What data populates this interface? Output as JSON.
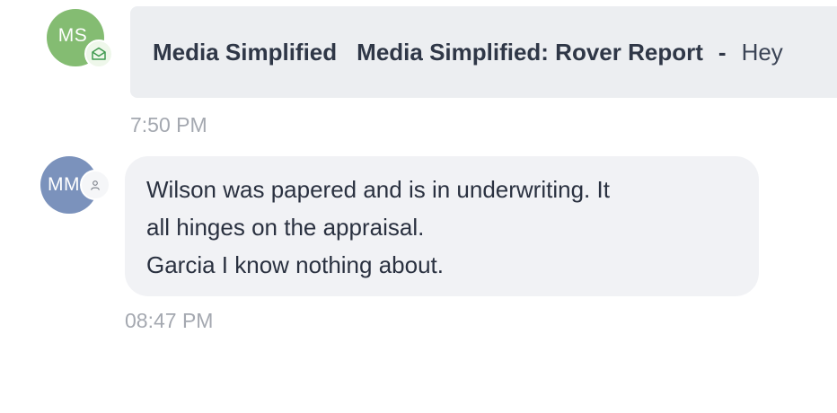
{
  "messages": [
    {
      "avatar": {
        "initials": "MS",
        "color": "#84bc72",
        "badge_icon": "mail-open-icon"
      },
      "sender": "Media Simplified",
      "subject": "Media Simplified: Rover Report",
      "separator": "-",
      "preview": "Hey",
      "timestamp": "7:50 PM"
    },
    {
      "avatar": {
        "initials": "MM",
        "color": "#7b92bc",
        "badge_icon": "person-icon"
      },
      "lines": [
        "Wilson was papered and is in underwriting. It",
        "all hinges on the appraisal.",
        "Garcia I know nothing about."
      ],
      "timestamp": "08:47 PM"
    }
  ]
}
